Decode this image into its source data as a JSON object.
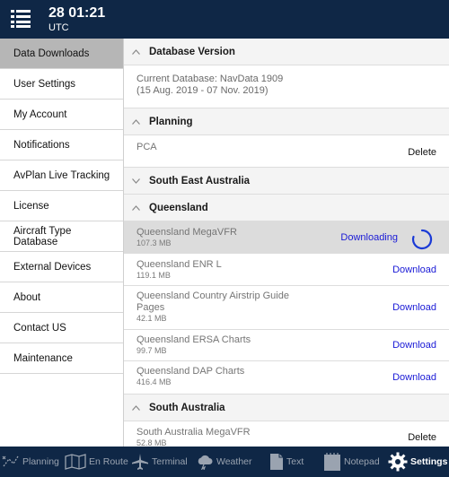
{
  "header": {
    "time": "28 01:21",
    "timezone": "UTC"
  },
  "sidebar": {
    "items": [
      {
        "label": "Data Downloads",
        "active": true
      },
      {
        "label": "User Settings"
      },
      {
        "label": "My Account"
      },
      {
        "label": "Notifications"
      },
      {
        "label": "AvPlan Live Tracking"
      },
      {
        "label": "License"
      },
      {
        "label": "Aircraft Type Database"
      },
      {
        "label": "External Devices"
      },
      {
        "label": "About"
      },
      {
        "label": "Contact US"
      },
      {
        "label": "Maintenance"
      }
    ]
  },
  "content": {
    "database": {
      "title": "Database Version",
      "line1": "Current Database: NavData 1909",
      "line2": "(15 Aug. 2019 - 07 Nov. 2019)"
    },
    "planning": {
      "title": "Planning",
      "item": "PCA",
      "action": "Delete"
    },
    "sea": {
      "title": "South East Australia"
    },
    "queensland": {
      "title": "Queensland",
      "items": [
        {
          "name": "Queensland MegaVFR",
          "size": "107.3 MB",
          "action": "Downloading"
        },
        {
          "name": "Queensland ENR L",
          "size": "119.1 MB",
          "action": "Download"
        },
        {
          "name": "Queensland Country Airstrip Guide Pages",
          "size": "42.1 MB",
          "action": "Download"
        },
        {
          "name": "Queensland ERSA Charts",
          "size": "99.7 MB",
          "action": "Download"
        },
        {
          "name": "Queensland DAP Charts",
          "size": "416.4 MB",
          "action": "Download"
        }
      ]
    },
    "sa": {
      "title": "South Australia",
      "items": [
        {
          "name": "South Australia MegaVFR",
          "size": "52.8 MB",
          "action": "Delete"
        }
      ]
    }
  },
  "bottom_tabs": [
    {
      "label": "Planning",
      "icon": "planning-icon"
    },
    {
      "label": "En Route",
      "icon": "map-icon"
    },
    {
      "label": "Terminal",
      "icon": "plane-icon"
    },
    {
      "label": "Weather",
      "icon": "weather-icon"
    },
    {
      "label": "Text",
      "icon": "document-icon"
    },
    {
      "label": "Notepad",
      "icon": "notepad-icon"
    },
    {
      "label": "Settings",
      "icon": "gear-icon",
      "active": true
    }
  ],
  "colors": {
    "header_bg": "#0f2746",
    "link": "#1a1ad6",
    "active_sidebar": "#b6b6b6"
  }
}
